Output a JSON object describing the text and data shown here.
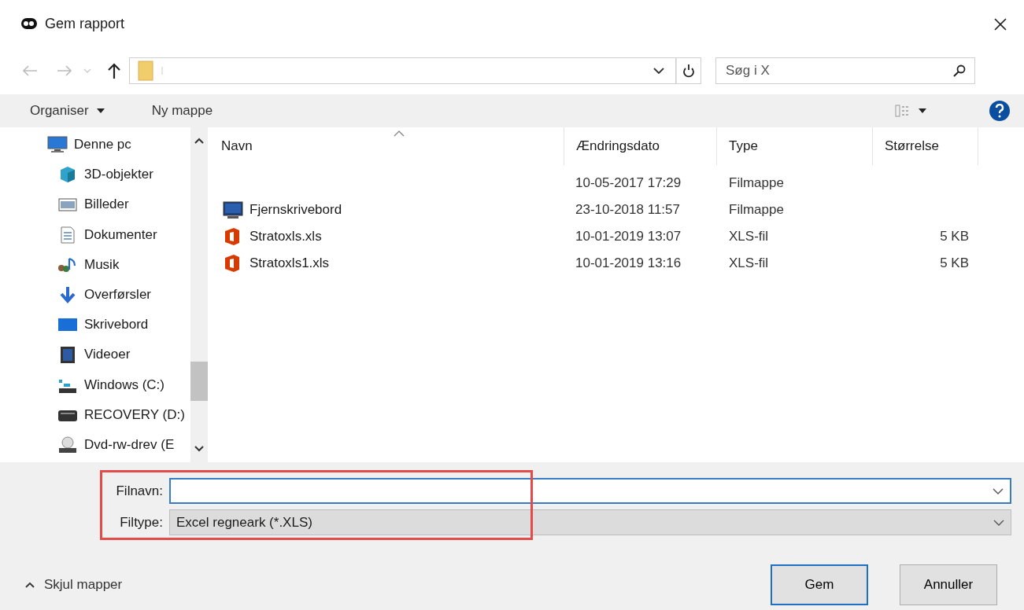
{
  "window": {
    "title": "Gem rapport"
  },
  "search": {
    "placeholder": "Søg i X"
  },
  "toolbar": {
    "buttons": [
      {
        "label": "Organiser",
        "has_menu": true
      },
      {
        "label": "Ny mappe",
        "has_menu": false
      }
    ]
  },
  "sidebar": {
    "items": [
      {
        "label": "Denne pc",
        "children": [
          {
            "label": "3D-objekter"
          },
          {
            "label": "Billeder"
          },
          {
            "label": "Dokumenter"
          },
          {
            "label": "Musik"
          },
          {
            "label": "Overførsler"
          },
          {
            "label": "Skrivebord"
          },
          {
            "label": "Videoer"
          },
          {
            "label": "Windows (C:)"
          },
          {
            "label": "RECOVERY (D:)"
          },
          {
            "label": "Dvd-rw-drev (E"
          }
        ]
      }
    ]
  },
  "table": {
    "columns": [
      {
        "label": "Navn",
        "sorted": true
      },
      {
        "label": "Ændringsdato",
        "sorted": false
      },
      {
        "label": "Type",
        "sorted": false
      },
      {
        "label": "Størrelse",
        "sorted": false
      }
    ],
    "rows": [
      {
        "date": "10-05-2017 17:29",
        "type": "Filmappe"
      },
      {
        "kind": "folder",
        "name": "Fjernskrivebord",
        "date": "23-10-2018 11:57",
        "type": "Filmappe"
      },
      {
        "kind": "spreadsheet",
        "name": "Stratoxls.xls",
        "date": "10-01-2019 13:07",
        "type": "XLS-fil",
        "size": "5 KB"
      },
      {
        "kind": "spreadsheet",
        "name": "Stratoxls1.xls",
        "date": "10-01-2019 13:16",
        "type": "XLS-fil",
        "size": "5 KB"
      }
    ]
  },
  "file_name": {
    "label": "Filnavn:",
    "focused": true
  },
  "file_type": {
    "label": "Filtype:",
    "value": "Excel regneark (*.XLS)"
  },
  "hide_folders": {
    "label": "Skjul mapper"
  },
  "buttons": [
    {
      "label": "Gem",
      "default": true
    },
    {
      "label": "Annuller",
      "default": false
    }
  ]
}
